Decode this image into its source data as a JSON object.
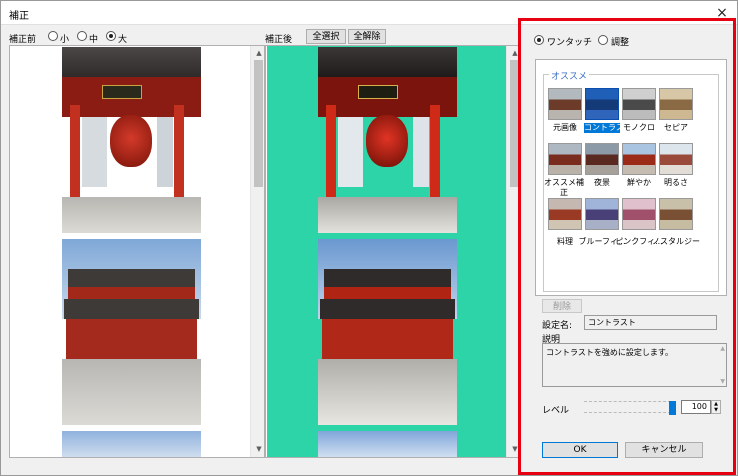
{
  "window": {
    "title": "補正",
    "close_glyph": "×"
  },
  "before": {
    "label": "補正前",
    "size_options": [
      "小",
      "中",
      "大"
    ],
    "selected_size": "大"
  },
  "after": {
    "label": "補正後",
    "select_all": "全選択",
    "deselect_all": "全解除"
  },
  "settings": {
    "mode_options": [
      "ワンタッチ",
      "調整"
    ],
    "selected_mode": "ワンタッチ",
    "presets_group_label": "オススメ",
    "presets": [
      "元画像",
      "コントラスト",
      "モノクロ",
      "セピア",
      "オススメ補正",
      "夜景",
      "鮮やか",
      "明るさ",
      "料理",
      "ブルーフィ...",
      "ピンクフィ...",
      "ノスタルジー"
    ],
    "selected_preset": "コントラスト",
    "delete_label": "削除",
    "setting_name_label": "設定名:",
    "setting_name_value": "コントラスト",
    "description_label": "説明",
    "description_value": "コントラストを強めに設定します。",
    "level_label": "レベル",
    "level_value": "100",
    "level_fraction": 1.0,
    "ok_label": "OK",
    "cancel_label": "キャンセル"
  },
  "colors": {
    "accent": "#0078d7",
    "highlight_bg": "#2dd4a8",
    "red_frame": "#e60012"
  }
}
